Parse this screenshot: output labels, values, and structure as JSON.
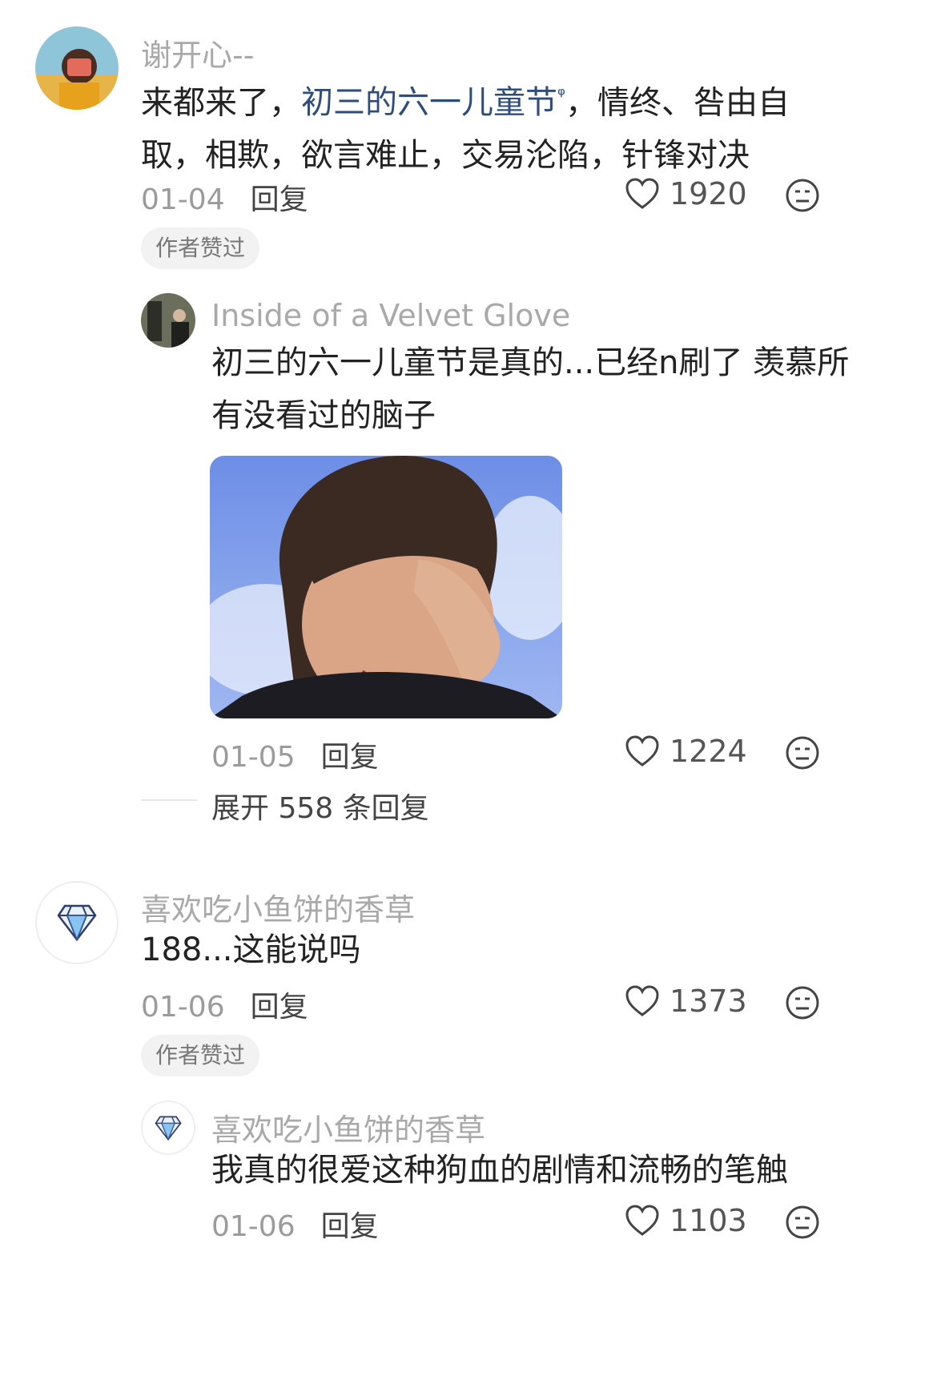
{
  "comments": [
    {
      "username": "谢开心--",
      "text_prefix": "来都来了，",
      "link_text": "初三的六一儿童节",
      "link_search_mark": "ᵠ",
      "text_suffix_line1": "，情终、咎由自",
      "text_line2": "取，相欺，欲言难止，交易沦陷，针锋对决",
      "date": "01-04",
      "reply_label": "回复",
      "likes": "1920",
      "badge": "作者赞过",
      "avatar_icon": "user-photo-avatar"
    },
    {
      "username": "Inside of a Velvet Glove",
      "text_line1": "初三的六一儿童节是真的...已经n刷了 羡慕所",
      "text_line2": "有没看过的脑子",
      "image_icon": "meme-image",
      "date": "01-05",
      "reply_label": "回复",
      "likes": "1224",
      "avatar_icon": "user-photo-avatar"
    },
    {
      "expand_label": "展开 558 条回复"
    },
    {
      "username": "喜欢吃小鱼饼的香草",
      "text_line1": "188...这能说吗",
      "date": "01-06",
      "reply_label": "回复",
      "likes": "1373",
      "badge": "作者赞过",
      "avatar_icon": "diamond-icon"
    },
    {
      "username": "喜欢吃小鱼饼的香草",
      "text_line1": "我真的很爱这种狗血的剧情和流畅的笔触",
      "date": "01-06",
      "reply_label": "回复",
      "likes": "1103",
      "avatar_icon": "diamond-icon"
    }
  ],
  "icons": {
    "like": "heart-outline-icon",
    "dislike": "meh-face-icon"
  },
  "colors": {
    "link": "#2f4d7a",
    "muted": "#a9a9a9"
  }
}
